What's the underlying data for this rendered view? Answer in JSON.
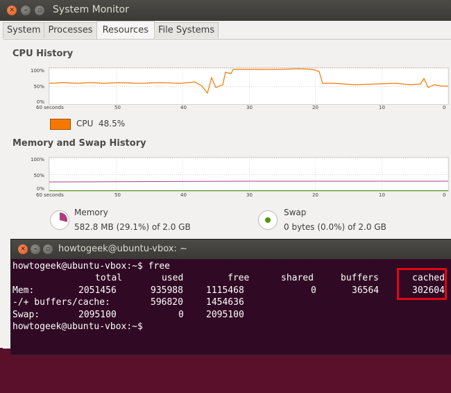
{
  "window": {
    "title": "System Monitor"
  },
  "tabs": [
    {
      "label": "System"
    },
    {
      "label": "Processes"
    },
    {
      "label": "Resources",
      "active": true
    },
    {
      "label": "File Systems"
    }
  ],
  "cpu_history": {
    "title": "CPU History",
    "y_ticks": [
      "100%",
      "50%",
      "0%"
    ],
    "x_ticks": [
      "60 seconds",
      "50",
      "40",
      "30",
      "20",
      "10",
      "0"
    ],
    "legend_label": "CPU",
    "legend_value": "48.5%",
    "line_color": "#f57900"
  },
  "memory_history": {
    "title": "Memory and Swap History",
    "y_ticks": [
      "100%",
      "50%",
      "0%"
    ],
    "x_ticks": [
      "60 seconds",
      "50",
      "40",
      "30",
      "20",
      "10",
      "0"
    ],
    "memory": {
      "label": "Memory",
      "value": "582.8 MB (29.1%) of 2.0 GB",
      "color": "#ad3e7e",
      "fraction": 0.291
    },
    "swap": {
      "label": "Swap",
      "value": "0 bytes (0.0%) of 2.0 GB",
      "color": "#4e9a06",
      "fraction": 0.0
    }
  },
  "terminal": {
    "title": "howtogeek@ubuntu-vbox: ~",
    "prompt_cmd": "howtogeek@ubuntu-vbox:~$ free",
    "header": [
      "total",
      "used",
      "free",
      "shared",
      "buffers",
      "cached"
    ],
    "rows": [
      {
        "label": "Mem:",
        "values": [
          "2051456",
          "935988",
          "1115468",
          "0",
          "36564",
          "302604"
        ]
      },
      {
        "label": "-/+ buffers/cache:",
        "values": [
          "",
          "596820",
          "1454636",
          "",
          "",
          ""
        ]
      },
      {
        "label": "Swap:",
        "values": [
          "2095100",
          "0",
          "2095100",
          "",
          "",
          ""
        ]
      }
    ],
    "prompt_end": "howtogeek@ubuntu-vbox:~$",
    "highlight_color": "#e30613"
  }
}
